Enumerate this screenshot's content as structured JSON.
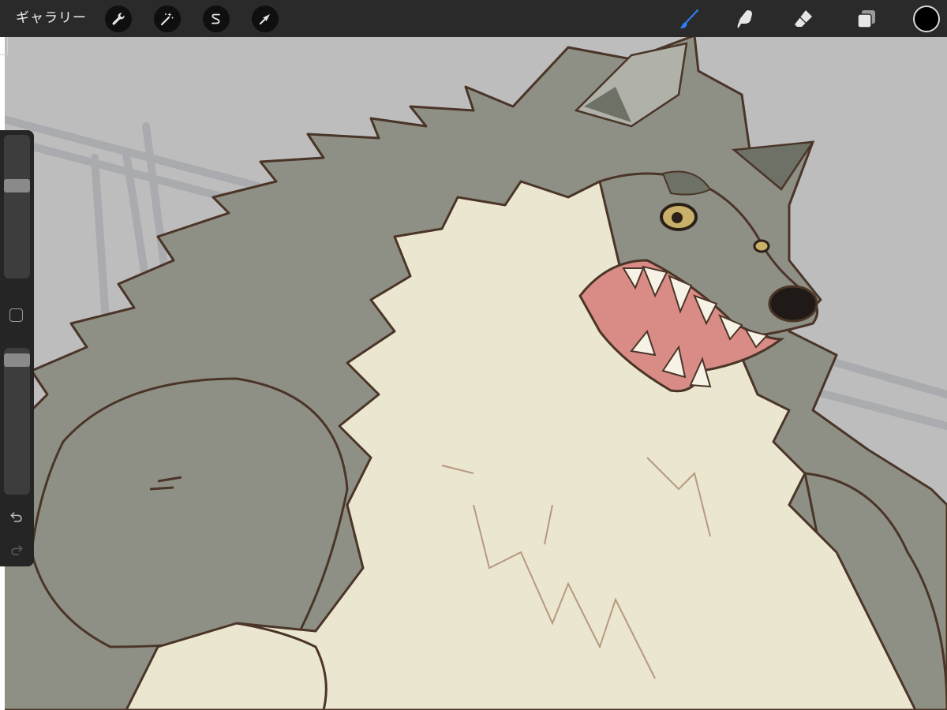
{
  "toolbar": {
    "gallery_label": "ギャラリー",
    "left_tools": [
      {
        "name": "actions",
        "icon": "wrench-icon"
      },
      {
        "name": "adjustments",
        "icon": "magic-wand-icon"
      },
      {
        "name": "selection",
        "icon": "selection-s-icon"
      },
      {
        "name": "transform",
        "icon": "arrow-cursor-icon"
      }
    ],
    "right_tools": [
      {
        "name": "brush",
        "icon": "brush-icon",
        "active": true
      },
      {
        "name": "smudge",
        "icon": "smudge-finger-icon",
        "active": false
      },
      {
        "name": "eraser",
        "icon": "eraser-icon",
        "active": false
      },
      {
        "name": "layers",
        "icon": "layers-icon",
        "active": false
      }
    ],
    "current_color": "#000000",
    "active_accent": "#2f7df6"
  },
  "sidebar": {
    "brush_size_level": 0.34,
    "opacity_level": 0.04,
    "modify_button": "square-icon",
    "undo": "undo-icon",
    "redo": "redo-icon"
  },
  "canvas": {
    "artwork": "werewolf-illustration",
    "palette": {
      "background": "#bdbdbd",
      "fur_grey": "#8f9085",
      "fur_dark": "#6e7266",
      "fur_cream": "#ebe6d0",
      "outline": "#4a3528",
      "mouth": "#d98c85",
      "eye": "#c9b06a"
    }
  }
}
